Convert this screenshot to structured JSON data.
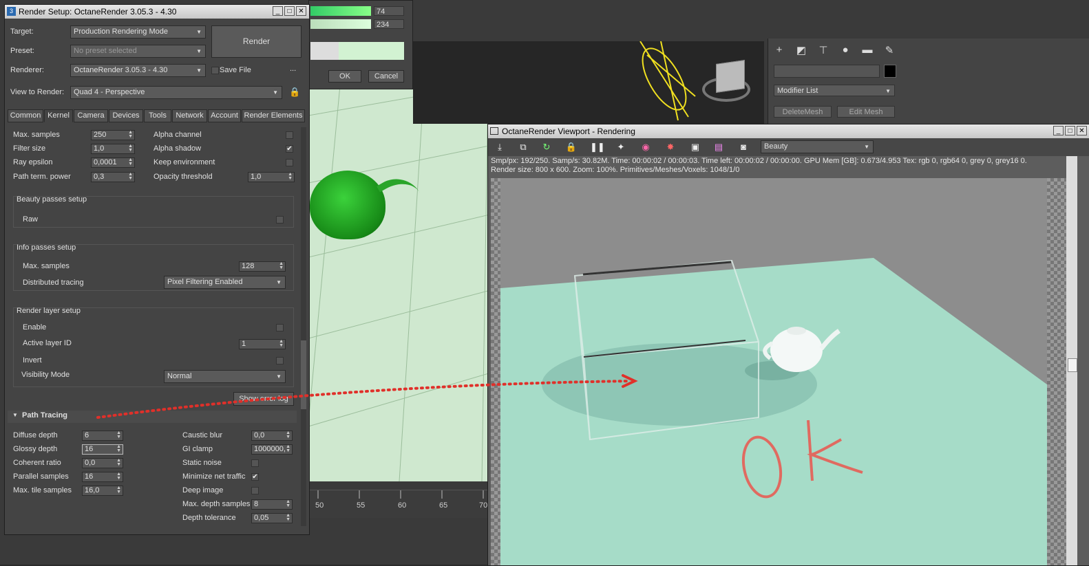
{
  "color_picker": {
    "values": [
      "74",
      "234"
    ],
    "ok_label": "OK",
    "cancel_label": "Cancel"
  },
  "render_setup": {
    "title": "Render Setup: OctaneRender 3.05.3 - 4.30",
    "target_label": "Target:",
    "target_value": "Production Rendering Mode",
    "preset_label": "Preset:",
    "preset_value": "No preset selected",
    "renderer_label": "Renderer:",
    "renderer_value": "OctaneRender 3.05.3 - 4.30",
    "save_file_label": "Save File",
    "more_label": "...",
    "render_button": "Render",
    "view_label": "View to Render:",
    "view_value": "Quad 4 - Perspective",
    "tabs": [
      "Common",
      "Kernel",
      "Camera",
      "Devices",
      "Tools",
      "Network",
      "Account",
      "Render Elements"
    ],
    "kernel": {
      "max_samples_label": "Max. samples",
      "max_samples": "250",
      "filter_size_label": "Filter size",
      "filter_size": "1,0",
      "ray_epsilon_label": "Ray epsilon",
      "ray_epsilon": "0,0001",
      "path_term_label": "Path term. power",
      "path_term": "0,3",
      "alpha_channel_label": "Alpha channel",
      "alpha_shadow_label": "Alpha shadow",
      "keep_env_label": "Keep environment",
      "opacity_label": "Opacity threshold",
      "opacity": "1,0"
    },
    "beauty": {
      "title": "Beauty passes setup",
      "raw_label": "Raw"
    },
    "info": {
      "title": "Info passes setup",
      "max_samples_label": "Max. samples",
      "max_samples": "128",
      "distributed_label": "Distributed tracing",
      "distributed_value": "Pixel Filtering Enabled"
    },
    "layer": {
      "title": "Render layer setup",
      "enable_label": "Enable",
      "active_id_label": "Active layer ID",
      "active_id": "1",
      "invert_label": "Invert",
      "visibility_label": "Visibility Mode",
      "visibility_value": "Normal"
    },
    "show_error_label": "Show error log",
    "path_tracing": {
      "title": "Path Tracing",
      "diffuse_label": "Diffuse depth",
      "diffuse": "6",
      "glossy_label": "Glossy depth",
      "glossy": "16",
      "coherent_label": "Coherent ratio",
      "coherent": "0,0",
      "parallel_label": "Parallel samples",
      "parallel": "16",
      "tile_label": "Max. tile samples",
      "tile": "16,0",
      "caustic_label": "Caustic blur",
      "caustic": "0,0",
      "gi_label": "GI clamp",
      "gi": "1000000,",
      "static_label": "Static noise",
      "minimize_label": "Minimize net traffic",
      "deep_label": "Deep image",
      "depth_samples_label": "Max. depth samples",
      "depth_samples": "8",
      "depth_tol_label": "Depth tolerance",
      "depth_tol": "0,05"
    }
  },
  "command_panel": {
    "modifier_list": "Modifier List",
    "delete_mesh": "DeleteMesh",
    "edit_mesh": "Edit Mesh"
  },
  "timeline": {
    "ticks": [
      "50",
      "55",
      "60",
      "65",
      "70"
    ]
  },
  "octane_viewport": {
    "title": "OctaneRender Viewport - Rendering",
    "pass_value": "Beauty",
    "stats_line1": "Smp/px: 192/250.   Samp/s: 30.82M.   Time: 00:00:02 / 00:00:03.   Time left: 00:00:02 / 00:00:00.   GPU Mem [GB]: 0.673/4.953   Tex: rgb 0, rgb64 0, grey 0, grey16 0.",
    "stats_line2": "Render size: 800 x 600.   Zoom: 100%.   Primitives/Meshes/Voxels: 1048/1/0"
  },
  "colors": {
    "accent_red": "#e0302a",
    "plane": "#a9ddc8",
    "teapot": "#22b022"
  }
}
